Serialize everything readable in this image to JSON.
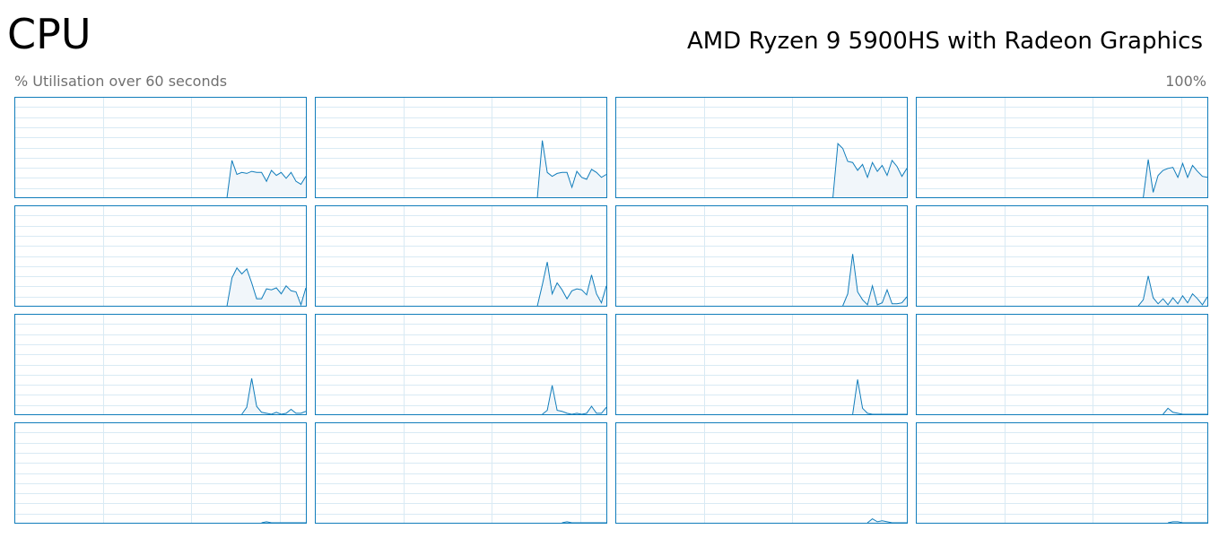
{
  "header": {
    "title": "CPU",
    "cpu_model": "AMD Ryzen 9 5900HS with Radeon Graphics",
    "utilisation_label": "% Utilisation over 60 seconds",
    "max_label": "100%"
  },
  "colors": {
    "graph_border": "#117dbb",
    "graph_line": "#117dbb",
    "graph_fill": "#f1f6fa",
    "grid_line": "#d9eaf4",
    "label_gray": "#707070"
  },
  "chart_data": {
    "type": "area",
    "x_range_seconds": [
      0,
      60
    ],
    "ylim": [
      0,
      100
    ],
    "grid": true,
    "series": [
      {
        "values": [
          0,
          0,
          0,
          0,
          0,
          0,
          0,
          0,
          0,
          0,
          0,
          0,
          0,
          0,
          0,
          0,
          0,
          0,
          0,
          0,
          0,
          0,
          0,
          0,
          0,
          0,
          0,
          0,
          0,
          0,
          0,
          0,
          0,
          0,
          0,
          0,
          0,
          0,
          0,
          0,
          0,
          0,
          0,
          37,
          23,
          25,
          24,
          26,
          25,
          25,
          16,
          27,
          22,
          25,
          19,
          25,
          16,
          13,
          21
        ]
      },
      {
        "values": [
          0,
          0,
          0,
          0,
          0,
          0,
          0,
          0,
          0,
          0,
          0,
          0,
          0,
          0,
          0,
          0,
          0,
          0,
          0,
          0,
          0,
          0,
          0,
          0,
          0,
          0,
          0,
          0,
          0,
          0,
          0,
          0,
          0,
          0,
          0,
          0,
          0,
          0,
          0,
          0,
          0,
          0,
          0,
          57,
          25,
          21,
          24,
          25,
          25,
          10,
          26,
          20,
          18,
          28,
          25,
          20,
          23
        ]
      },
      {
        "values": [
          0,
          0,
          0,
          0,
          0,
          0,
          0,
          0,
          0,
          0,
          0,
          0,
          0,
          0,
          0,
          0,
          0,
          0,
          0,
          0,
          0,
          0,
          0,
          0,
          0,
          0,
          0,
          0,
          0,
          0,
          0,
          0,
          0,
          0,
          0,
          0,
          0,
          0,
          0,
          0,
          0,
          0,
          0,
          54,
          49,
          36,
          35,
          27,
          33,
          20,
          35,
          26,
          32,
          22,
          37,
          31,
          21,
          29
        ]
      },
      {
        "values": [
          0,
          0,
          0,
          0,
          0,
          0,
          0,
          0,
          0,
          0,
          0,
          0,
          0,
          0,
          0,
          0,
          0,
          0,
          0,
          0,
          0,
          0,
          0,
          0,
          0,
          0,
          0,
          0,
          0,
          0,
          0,
          0,
          0,
          0,
          0,
          0,
          0,
          0,
          0,
          0,
          0,
          0,
          0,
          38,
          5,
          22,
          27,
          29,
          30,
          20,
          34,
          20,
          32,
          26,
          21,
          20
        ]
      },
      {
        "values": [
          0,
          0,
          0,
          0,
          0,
          0,
          0,
          0,
          0,
          0,
          0,
          0,
          0,
          0,
          0,
          0,
          0,
          0,
          0,
          0,
          0,
          0,
          0,
          0,
          0,
          0,
          0,
          0,
          0,
          0,
          0,
          0,
          0,
          0,
          0,
          0,
          0,
          0,
          0,
          0,
          0,
          0,
          0,
          28,
          38,
          32,
          37,
          23,
          7,
          7,
          17,
          16,
          18,
          12,
          20,
          15,
          14,
          1,
          18
        ]
      },
      {
        "values": [
          0,
          0,
          0,
          0,
          0,
          0,
          0,
          0,
          0,
          0,
          0,
          0,
          0,
          0,
          0,
          0,
          0,
          0,
          0,
          0,
          0,
          0,
          0,
          0,
          0,
          0,
          0,
          0,
          0,
          0,
          0,
          0,
          0,
          0,
          0,
          0,
          0,
          0,
          0,
          0,
          0,
          0,
          0,
          21,
          44,
          12,
          23,
          16,
          7,
          15,
          17,
          16,
          11,
          31,
          12,
          3,
          20
        ]
      },
      {
        "values": [
          0,
          0,
          0,
          0,
          0,
          0,
          0,
          0,
          0,
          0,
          0,
          0,
          0,
          0,
          0,
          0,
          0,
          0,
          0,
          0,
          0,
          0,
          0,
          0,
          0,
          0,
          0,
          0,
          0,
          0,
          0,
          0,
          0,
          0,
          0,
          0,
          0,
          0,
          0,
          0,
          0,
          0,
          0,
          12,
          52,
          14,
          6,
          1,
          20,
          1,
          3,
          16,
          2,
          2,
          3,
          9
        ]
      },
      {
        "values": [
          0,
          0,
          0,
          0,
          0,
          0,
          0,
          0,
          0,
          0,
          0,
          0,
          0,
          0,
          0,
          0,
          0,
          0,
          0,
          0,
          0,
          0,
          0,
          0,
          0,
          0,
          0,
          0,
          0,
          0,
          0,
          0,
          0,
          0,
          0,
          0,
          0,
          0,
          0,
          0,
          0,
          0,
          0,
          6,
          30,
          8,
          2,
          7,
          1,
          8,
          2,
          10,
          3,
          12,
          7,
          1,
          9
        ]
      },
      {
        "values": [
          0,
          0,
          0,
          0,
          0,
          0,
          0,
          0,
          0,
          0,
          0,
          0,
          0,
          0,
          0,
          0,
          0,
          0,
          0,
          0,
          0,
          0,
          0,
          0,
          0,
          0,
          0,
          0,
          0,
          0,
          0,
          0,
          0,
          0,
          0,
          0,
          0,
          0,
          0,
          0,
          0,
          0,
          0,
          7,
          36,
          8,
          2,
          1,
          0,
          2,
          0,
          1,
          5,
          1,
          1,
          3
        ]
      },
      {
        "values": [
          0,
          0,
          0,
          0,
          0,
          0,
          0,
          0,
          0,
          0,
          0,
          0,
          0,
          0,
          0,
          0,
          0,
          0,
          0,
          0,
          0,
          0,
          0,
          0,
          0,
          0,
          0,
          0,
          0,
          0,
          0,
          0,
          0,
          0,
          0,
          0,
          0,
          0,
          0,
          0,
          0,
          0,
          0,
          4,
          29,
          4,
          3,
          1,
          0,
          1,
          0,
          1,
          8,
          1,
          1,
          7
        ]
      },
      {
        "values": [
          0,
          0,
          0,
          0,
          0,
          0,
          0,
          0,
          0,
          0,
          0,
          0,
          0,
          0,
          0,
          0,
          0,
          0,
          0,
          0,
          0,
          0,
          0,
          0,
          0,
          0,
          0,
          0,
          0,
          0,
          0,
          0,
          0,
          0,
          0,
          0,
          0,
          0,
          0,
          0,
          0,
          0,
          0,
          0,
          0,
          35,
          6,
          1,
          0,
          0,
          0,
          0,
          0,
          0,
          0,
          0
        ]
      },
      {
        "values": [
          0,
          0,
          0,
          0,
          0,
          0,
          0,
          0,
          0,
          0,
          0,
          0,
          0,
          0,
          0,
          0,
          0,
          0,
          0,
          0,
          0,
          0,
          0,
          0,
          0,
          0,
          0,
          0,
          0,
          0,
          0,
          0,
          0,
          0,
          0,
          0,
          0,
          0,
          0,
          0,
          0,
          0,
          0,
          0,
          0,
          0,
          0,
          6,
          2,
          1,
          0,
          0,
          0,
          0,
          0,
          0
        ]
      },
      {
        "values": [
          0,
          0,
          0,
          0,
          0,
          0,
          0,
          0,
          0,
          0,
          0,
          0,
          0,
          0,
          0,
          0,
          0,
          0,
          0,
          0,
          0,
          0,
          0,
          0,
          0,
          0,
          0,
          0,
          0,
          0,
          0,
          0,
          0,
          0,
          0,
          0,
          0,
          0,
          0,
          0,
          0,
          0,
          0,
          0,
          0,
          0,
          0,
          1,
          0,
          0,
          0,
          0,
          0,
          0,
          0,
          0
        ]
      },
      {
        "values": [
          0,
          0,
          0,
          0,
          0,
          0,
          0,
          0,
          0,
          0,
          0,
          0,
          0,
          0,
          0,
          0,
          0,
          0,
          0,
          0,
          0,
          0,
          0,
          0,
          0,
          0,
          0,
          0,
          0,
          0,
          0,
          0,
          0,
          0,
          0,
          0,
          0,
          0,
          0,
          0,
          0,
          0,
          0,
          0,
          0,
          0,
          0,
          1,
          0,
          0,
          0,
          0,
          0,
          0,
          0,
          0
        ]
      },
      {
        "values": [
          0,
          0,
          0,
          0,
          0,
          0,
          0,
          0,
          0,
          0,
          0,
          0,
          0,
          0,
          0,
          0,
          0,
          0,
          0,
          0,
          0,
          0,
          0,
          0,
          0,
          0,
          0,
          0,
          0,
          0,
          0,
          0,
          0,
          0,
          0,
          0,
          0,
          0,
          0,
          0,
          0,
          0,
          0,
          0,
          0,
          0,
          0,
          0,
          4,
          1,
          2,
          1,
          0,
          0,
          0,
          0
        ]
      },
      {
        "values": [
          0,
          0,
          0,
          0,
          0,
          0,
          0,
          0,
          0,
          0,
          0,
          0,
          0,
          0,
          0,
          0,
          0,
          0,
          0,
          0,
          0,
          0,
          0,
          0,
          0,
          0,
          0,
          0,
          0,
          0,
          0,
          0,
          0,
          0,
          0,
          0,
          0,
          0,
          0,
          0,
          0,
          0,
          0,
          0,
          0,
          0,
          0,
          0,
          1,
          1,
          0,
          0,
          0,
          0,
          0,
          0
        ]
      }
    ]
  }
}
